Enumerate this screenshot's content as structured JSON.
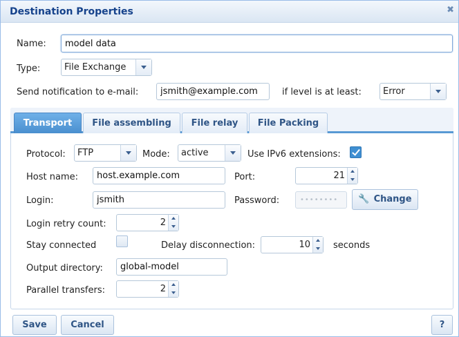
{
  "dialog": {
    "title": "Destination Properties",
    "close_glyph": "✖"
  },
  "form": {
    "name_label": "Name:",
    "name_value": "model data",
    "type_label": "Type:",
    "type_value": "File Exchange",
    "email_label": "Send notification to e-mail:",
    "email_value": "jsmith@example.com",
    "level_label": "if level is at least:",
    "level_value": "Error"
  },
  "tabs": [
    {
      "label": "Transport",
      "active": true
    },
    {
      "label": "File assembling",
      "active": false
    },
    {
      "label": "File relay",
      "active": false
    },
    {
      "label": "File Packing",
      "active": false
    }
  ],
  "transport": {
    "protocol_label": "Protocol:",
    "protocol_value": "FTP",
    "mode_label": "Mode:",
    "mode_value": "active",
    "ipv6_label": "Use IPv6 extensions:",
    "ipv6_checked": true,
    "host_label": "Host name:",
    "host_value": "host.example.com",
    "port_label": "Port:",
    "port_value": "21",
    "login_label": "Login:",
    "login_value": "jsmith",
    "password_label": "Password:",
    "password_mask": "••••••••",
    "change_label": "Change",
    "retry_label": "Login retry count:",
    "retry_value": "2",
    "stay_label": "Stay connected",
    "stay_checked": false,
    "delay_label": "Delay disconnection:",
    "delay_value": "10",
    "delay_unit": "seconds",
    "outdir_label": "Output directory:",
    "outdir_value": "global-model",
    "parallel_label": "Parallel transfers:",
    "parallel_value": "2"
  },
  "footer": {
    "save_label": "Save",
    "cancel_label": "Cancel",
    "help_label": "?"
  }
}
